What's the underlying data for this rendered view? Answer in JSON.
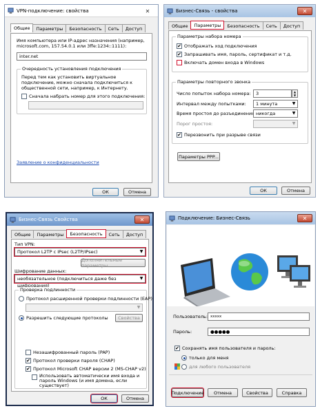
{
  "d1": {
    "title": "VPN-подключение: свойства",
    "tabs": [
      "Общие",
      "Параметры",
      "Безопасность",
      "Сеть",
      "Доступ"
    ],
    "host_label": "Имя компьютера или IP-адрес назначения (например, microsoft.com, 157.54.0.1 или 3ffe:1234::1111):",
    "host_value": "inter.net",
    "group_title": "Очередность установления подключения",
    "group_text": "Перед тем как установить виртуальное подключение, можно сначала подключиться к общественной сети, например, к Интернету.",
    "dial_first_label": "Сначала набрать номер для этого подключения:",
    "privacy_link": "Заявление о конфиденциальности",
    "ok": "ОК",
    "cancel": "Отмена"
  },
  "d2": {
    "title": "Бизнес-Связь - свойства",
    "tabs": [
      "Общие",
      "Параметры",
      "Безопасность",
      "Сеть",
      "Доступ"
    ],
    "dial_group": "Параметры набора номера",
    "opt_progress": "Отображать ход подключения",
    "opt_prompt": "Запрашивать имя, пароль, сертификат и т.д.",
    "opt_domain": "Включать домен входа в Windows",
    "redial_group": "Параметры повторного звонка",
    "redial_attempts_label": "Число попыток набора номера:",
    "redial_attempts_value": "3",
    "interval_label": "Интервал между попытками:",
    "interval_value": "1 минута",
    "idle_label": "Время простоя до разъединения:",
    "idle_value": "никогда",
    "threshold_label": "Порог простоя:",
    "redial_on_drop": "Перезвонить при разрыве связи",
    "ppp_button": "Параметры PPP...",
    "ok": "ОК",
    "cancel": "Отмена"
  },
  "d3": {
    "title": "Бизнес-Связь Свойства",
    "tabs": [
      "Общие",
      "Параметры",
      "Безопасность",
      "Сеть",
      "Доступ"
    ],
    "vpn_type_label": "Тип VPN:",
    "vpn_type_value": "Протокол L2TP с IPsec (L2TP/IPsec)",
    "advanced_button": "Дополнительные параметры",
    "encryption_label": "Шифрование данных:",
    "encryption_value": "необязательное (подключиться даже без шифрования)",
    "auth_group": "Проверка подлинности",
    "eap_label": "Протокол расширенной проверки подлинности (EAP)",
    "properties_button": "Свойства",
    "allow_label": "Разрешить следующие протоколы",
    "pap_label": "Незашифрованный пароль (PAP)",
    "chap_label": "Протокол проверки пароля (CHAP)",
    "mschap_label": "Протокол Microsoft CHAP версии 2 (MS-CHAP v2)",
    "auto_login_label": "Использовать автоматически имя входа и пароль Windows (и имя домена, если существует)",
    "ok": "ОК",
    "cancel": "Отмена"
  },
  "d4": {
    "title": "Подключение: Бизнес-Связь",
    "user_label": "Пользователь:",
    "user_value": "xxxxx",
    "password_label": "Пароль:",
    "password_value": "●●●●●",
    "save_label": "Сохранять имя пользователя и пароль:",
    "only_me": "только для меня",
    "any_user": "для любого пользователя",
    "connect": "Подключение",
    "cancel": "Отмена",
    "properties": "Свойства",
    "help": "Справка"
  },
  "colors": {
    "highlight": "#d0102c",
    "titlebar_blue": "#a8c4e4",
    "link": "#1a4ab0"
  }
}
